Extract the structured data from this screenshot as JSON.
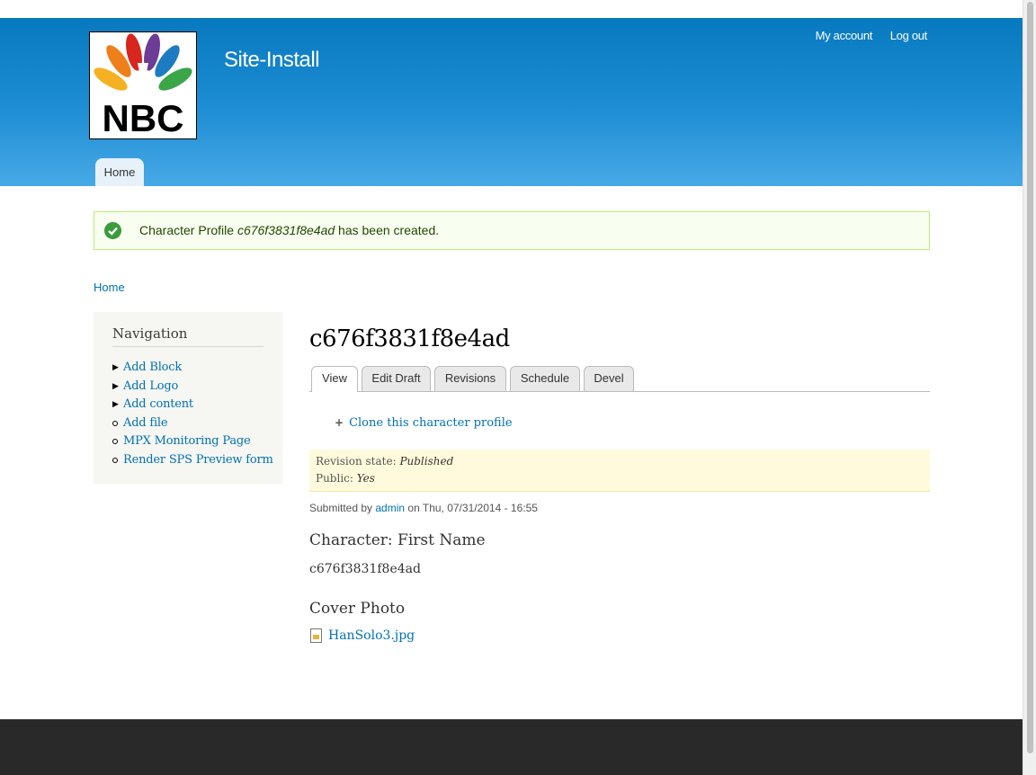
{
  "header": {
    "site_name": "Site-Install",
    "logo_text": "NBC",
    "secondary_menu": [
      "My account",
      "Log out"
    ],
    "main_menu": [
      "Home"
    ]
  },
  "message": {
    "prefix": "Character Profile ",
    "node_id": "c676f3831f8e4ad",
    "suffix": " has been created."
  },
  "breadcrumb": [
    "Home"
  ],
  "sidebar": {
    "title": "Navigation",
    "items": [
      {
        "label": "Add Block",
        "expandable": true
      },
      {
        "label": "Add Logo",
        "expandable": true
      },
      {
        "label": "Add content",
        "expandable": true
      },
      {
        "label": "Add file",
        "expandable": false
      },
      {
        "label": "MPX Monitoring Page",
        "expandable": false
      },
      {
        "label": "Render SPS Preview form",
        "expandable": false
      }
    ]
  },
  "node": {
    "title": "c676f3831f8e4ad",
    "tabs": [
      "View",
      "Edit Draft",
      "Revisions",
      "Schedule",
      "Devel"
    ],
    "active_tab": "View",
    "clone_link": "Clone this character profile",
    "revision": {
      "state_label": "Revision state: ",
      "state_value": "Published",
      "public_label": "Public: ",
      "public_value": "Yes"
    },
    "submitted": {
      "prefix": "Submitted by ",
      "author": "admin",
      "suffix": " on Thu, 07/31/2014 - 16:55"
    },
    "fields": {
      "first_name_label": "Character: First Name",
      "first_name_value": "c676f3831f8e4ad",
      "cover_photo_label": "Cover Photo",
      "cover_photo_file": "HanSolo3.jpg"
    }
  },
  "colors": {
    "header_top": "#0779bf",
    "header_bottom": "#48a9e6",
    "link": "#0071b3",
    "message_bg": "#f8fff0",
    "revision_bg": "#fffadb",
    "footer": "#292929"
  }
}
